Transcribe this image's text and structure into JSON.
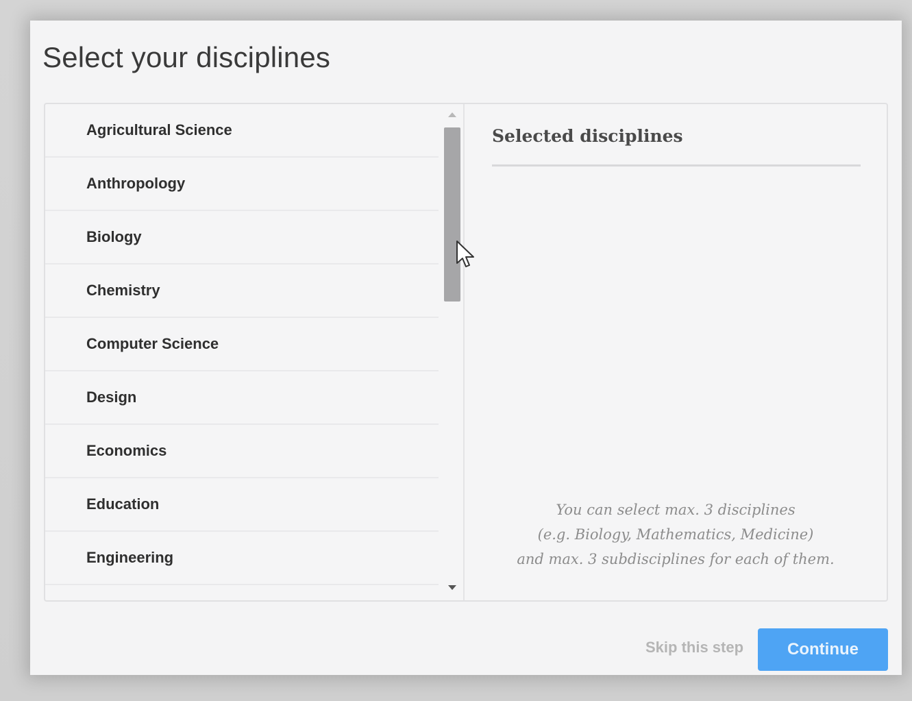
{
  "dialog": {
    "title": "Select your disciplines"
  },
  "disciplines": [
    "Agricultural Science",
    "Anthropology",
    "Biology",
    "Chemistry",
    "Computer Science",
    "Design",
    "Economics",
    "Education",
    "Engineering"
  ],
  "selected": {
    "title": "Selected disciplines",
    "hint_line1": "You can select max. 3 disciplines",
    "hint_line2": "(e.g. Biology, Mathematics, Medicine)",
    "hint_line3": "and max. 3 subdisciplines for each of them."
  },
  "footer": {
    "skip_label": "Skip this step",
    "continue_label": "Continue"
  },
  "colors": {
    "accent": "#4ea4f4",
    "dialog_bg": "#f4f4f5",
    "backdrop": "#d6d6d6"
  },
  "icons": {
    "scroll_up": "triangle-up-icon",
    "scroll_down": "triangle-down-icon",
    "cursor": "mouse-pointer-icon"
  }
}
